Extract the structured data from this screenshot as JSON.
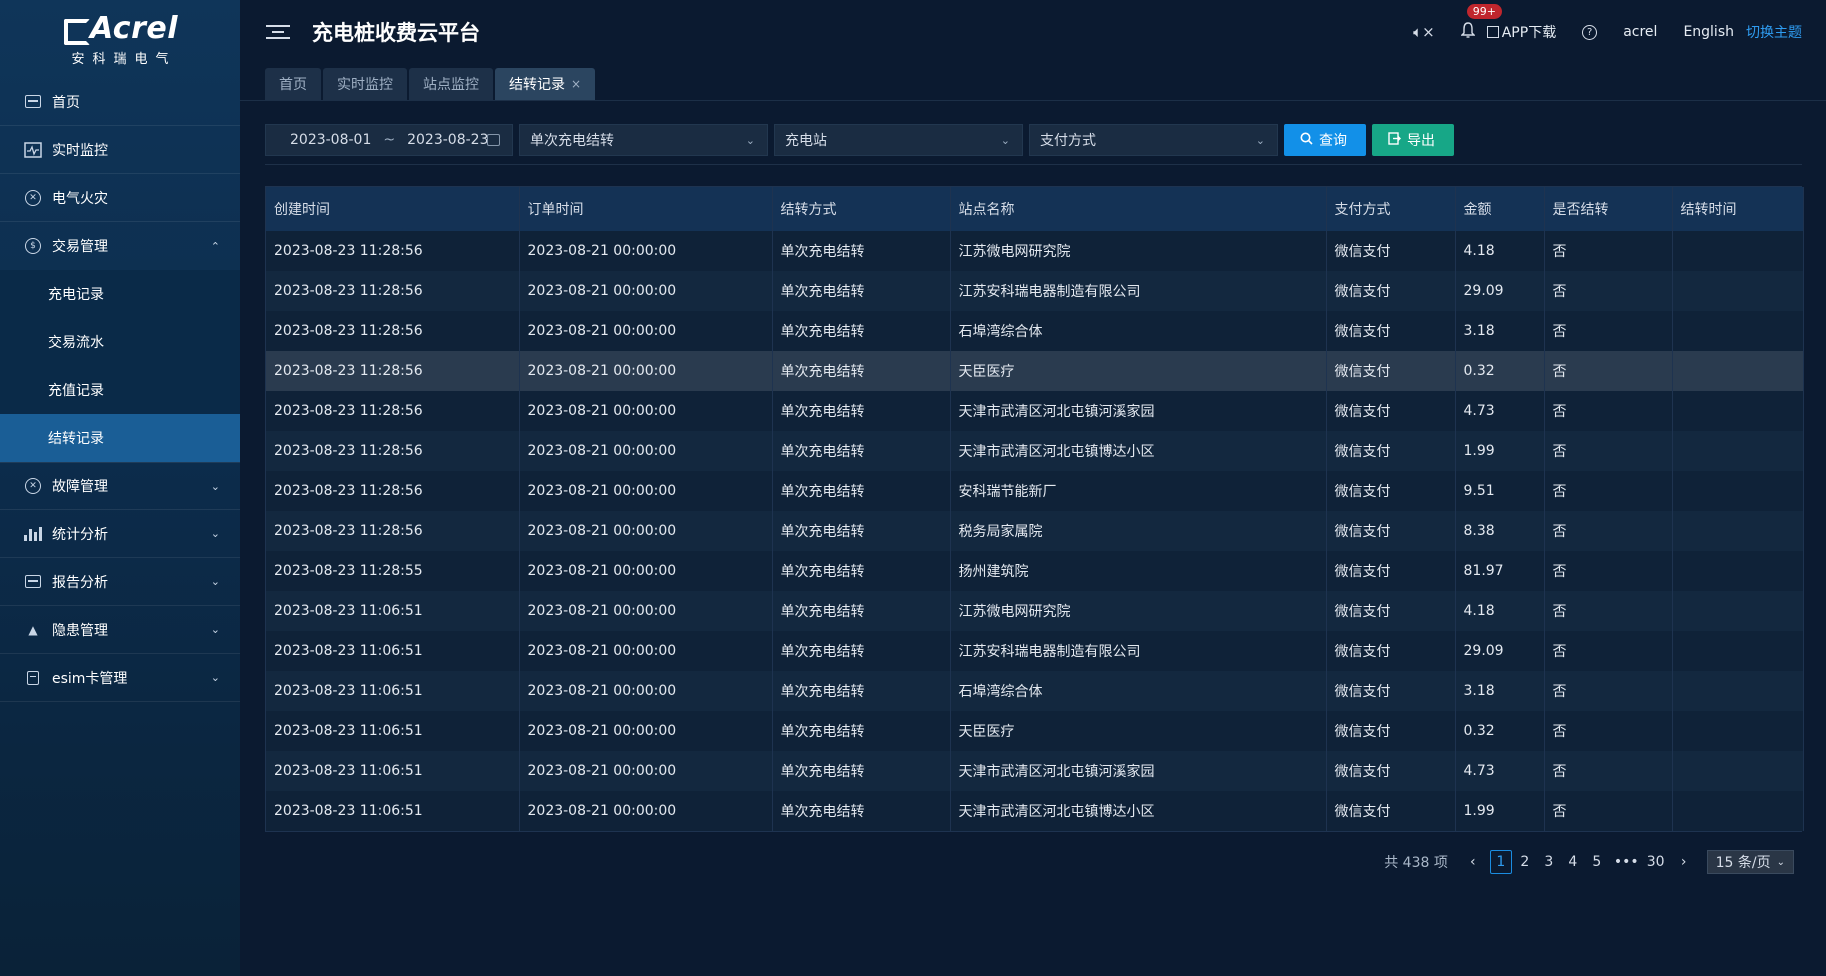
{
  "brand": {
    "name": "Acrel",
    "sub": "安科瑞电气"
  },
  "app_title": "充电桩收费云平台",
  "header": {
    "mute_icon": "speaker-mute-icon",
    "notify_badge": "99+",
    "app_download": "APP下载",
    "user": "acrel",
    "language": "English",
    "theme_switch": "切换主题"
  },
  "sidebar": {
    "items": [
      {
        "label": "首页",
        "icon": "dashboard-icon"
      },
      {
        "label": "实时监控",
        "icon": "monitor-icon"
      },
      {
        "label": "电气火灾",
        "icon": "fire-icon"
      },
      {
        "label": "交易管理",
        "icon": "transaction-icon",
        "expanded": true
      },
      {
        "label": "故障管理",
        "icon": "fault-icon"
      },
      {
        "label": "统计分析",
        "icon": "stats-icon"
      },
      {
        "label": "报告分析",
        "icon": "report-icon"
      },
      {
        "label": "隐患管理",
        "icon": "warning-icon"
      },
      {
        "label": "esim卡管理",
        "icon": "sim-icon"
      }
    ],
    "sub_items": [
      {
        "label": "充电记录"
      },
      {
        "label": "交易流水"
      },
      {
        "label": "充值记录"
      },
      {
        "label": "结转记录",
        "active": true
      }
    ]
  },
  "tabs": [
    {
      "label": "首页"
    },
    {
      "label": "实时监控"
    },
    {
      "label": "站点监控"
    },
    {
      "label": "结转记录",
      "active": true
    }
  ],
  "filters": {
    "date_start": "2023-08-01",
    "date_sep": "~",
    "date_end": "2023-08-23",
    "settle_type": "单次充电结转",
    "station": "充电站",
    "pay_method": "支付方式",
    "query_label": "查询",
    "export_label": "导出"
  },
  "table": {
    "columns": [
      "创建时间",
      "订单时间",
      "结转方式",
      "站点名称",
      "支付方式",
      "金额",
      "是否结转",
      "结转时间"
    ],
    "rows": [
      [
        "2023-08-23 11:28:56",
        "2023-08-21 00:00:00",
        "单次充电结转",
        "江苏微电网研究院",
        "微信支付",
        "4.18",
        "否",
        ""
      ],
      [
        "2023-08-23 11:28:56",
        "2023-08-21 00:00:00",
        "单次充电结转",
        "江苏安科瑞电器制造有限公司",
        "微信支付",
        "29.09",
        "否",
        ""
      ],
      [
        "2023-08-23 11:28:56",
        "2023-08-21 00:00:00",
        "单次充电结转",
        "石埠湾综合体",
        "微信支付",
        "3.18",
        "否",
        ""
      ],
      [
        "2023-08-23 11:28:56",
        "2023-08-21 00:00:00",
        "单次充电结转",
        "天臣医疗",
        "微信支付",
        "0.32",
        "否",
        ""
      ],
      [
        "2023-08-23 11:28:56",
        "2023-08-21 00:00:00",
        "单次充电结转",
        "天津市武清区河北屯镇河溪家园",
        "微信支付",
        "4.73",
        "否",
        ""
      ],
      [
        "2023-08-23 11:28:56",
        "2023-08-21 00:00:00",
        "单次充电结转",
        "天津市武清区河北屯镇博达小区",
        "微信支付",
        "1.99",
        "否",
        ""
      ],
      [
        "2023-08-23 11:28:56",
        "2023-08-21 00:00:00",
        "单次充电结转",
        "安科瑞节能新厂",
        "微信支付",
        "9.51",
        "否",
        ""
      ],
      [
        "2023-08-23 11:28:56",
        "2023-08-21 00:00:00",
        "单次充电结转",
        "税务局家属院",
        "微信支付",
        "8.38",
        "否",
        ""
      ],
      [
        "2023-08-23 11:28:55",
        "2023-08-21 00:00:00",
        "单次充电结转",
        "扬州建筑院",
        "微信支付",
        "81.97",
        "否",
        ""
      ],
      [
        "2023-08-23 11:06:51",
        "2023-08-21 00:00:00",
        "单次充电结转",
        "江苏微电网研究院",
        "微信支付",
        "4.18",
        "否",
        ""
      ],
      [
        "2023-08-23 11:06:51",
        "2023-08-21 00:00:00",
        "单次充电结转",
        "江苏安科瑞电器制造有限公司",
        "微信支付",
        "29.09",
        "否",
        ""
      ],
      [
        "2023-08-23 11:06:51",
        "2023-08-21 00:00:00",
        "单次充电结转",
        "石埠湾综合体",
        "微信支付",
        "3.18",
        "否",
        ""
      ],
      [
        "2023-08-23 11:06:51",
        "2023-08-21 00:00:00",
        "单次充电结转",
        "天臣医疗",
        "微信支付",
        "0.32",
        "否",
        ""
      ],
      [
        "2023-08-23 11:06:51",
        "2023-08-21 00:00:00",
        "单次充电结转",
        "天津市武清区河北屯镇河溪家园",
        "微信支付",
        "4.73",
        "否",
        ""
      ],
      [
        "2023-08-23 11:06:51",
        "2023-08-21 00:00:00",
        "单次充电结转",
        "天津市武清区河北屯镇博达小区",
        "微信支付",
        "1.99",
        "否",
        ""
      ]
    ],
    "hover_row": 3
  },
  "pagination": {
    "total": "共 438 项",
    "pages": [
      "1",
      "2",
      "3",
      "4",
      "5"
    ],
    "ellipsis": "•••",
    "last": "30",
    "current": "1",
    "page_size": "15 条/页"
  },
  "colors": {
    "accent": "#1290e8",
    "export": "#17a787",
    "active_nav": "#1a5e96",
    "badge": "#c0262d"
  }
}
